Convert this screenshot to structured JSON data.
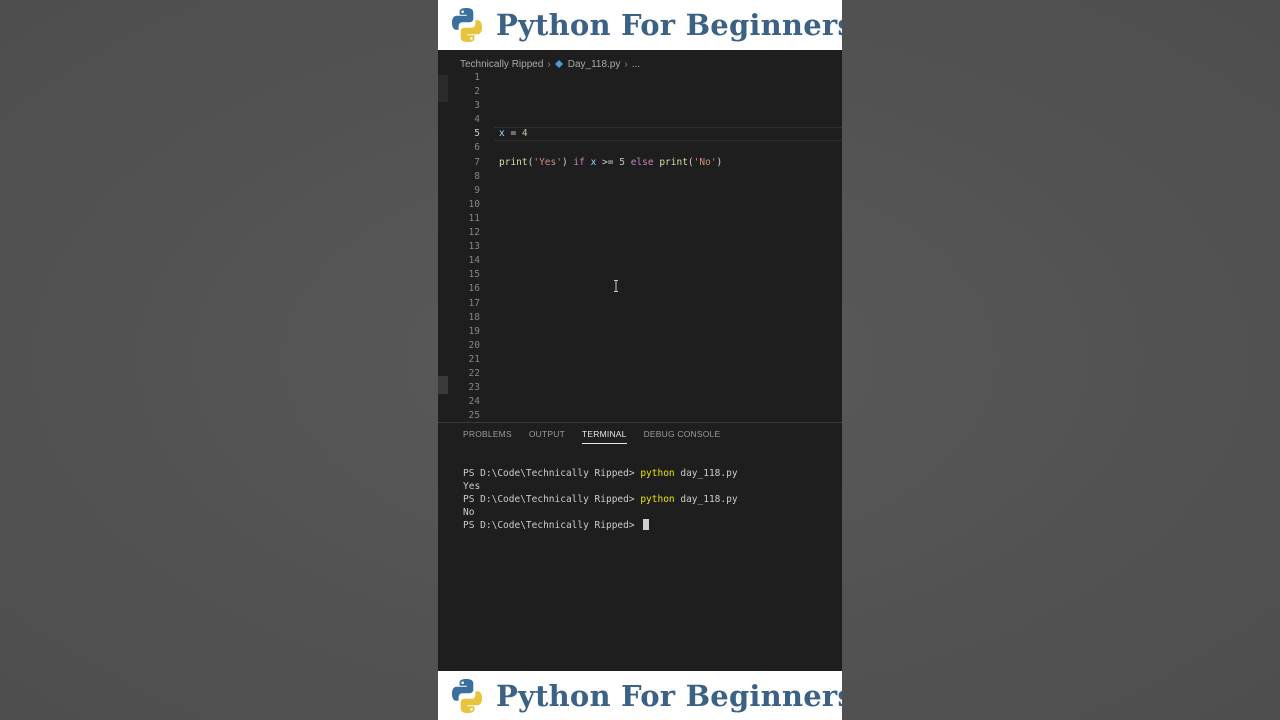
{
  "banner": {
    "title": "Python For Beginners"
  },
  "breadcrumb": {
    "folder": "Technically Ripped",
    "file": "Day_118.py",
    "ellipsis": "..."
  },
  "editor": {
    "line_numbers": [
      "1",
      "2",
      "3",
      "4",
      "5",
      "6",
      "7",
      "8",
      "9",
      "10",
      "11",
      "12",
      "13",
      "14",
      "15",
      "16",
      "17",
      "18",
      "19",
      "20",
      "21",
      "22",
      "23",
      "24",
      "25"
    ],
    "active_line": 5,
    "line5": {
      "var": "x",
      "op": " = ",
      "num": "4"
    },
    "line7": {
      "fn1": "print",
      "p1": "(",
      "s1": "'Yes'",
      "p2": ") ",
      "kw1": "if",
      "sp1": " ",
      "var": "x",
      "op": " >= ",
      "num": "5",
      "sp2": " ",
      "kw2": "else",
      "sp3": " ",
      "fn2": "print",
      "p3": "(",
      "s2": "'No'",
      "p4": ")"
    }
  },
  "panel": {
    "tabs": [
      {
        "label": "PROBLEMS",
        "active": false
      },
      {
        "label": "OUTPUT",
        "active": false
      },
      {
        "label": "TERMINAL",
        "active": true
      },
      {
        "label": "DEBUG CONSOLE",
        "active": false
      }
    ]
  },
  "terminal": {
    "prompt": "PS D:\\Code\\Technically Ripped> ",
    "cmd1": "python",
    "arg1": " day_118.py",
    "out1": "Yes",
    "cmd2": "python",
    "arg2": " day_118.py",
    "out2": "No"
  },
  "colors": {
    "banner_text": "#3b6184",
    "editor_bg": "#1e1e1e",
    "terminal_command": "#e5e510"
  }
}
